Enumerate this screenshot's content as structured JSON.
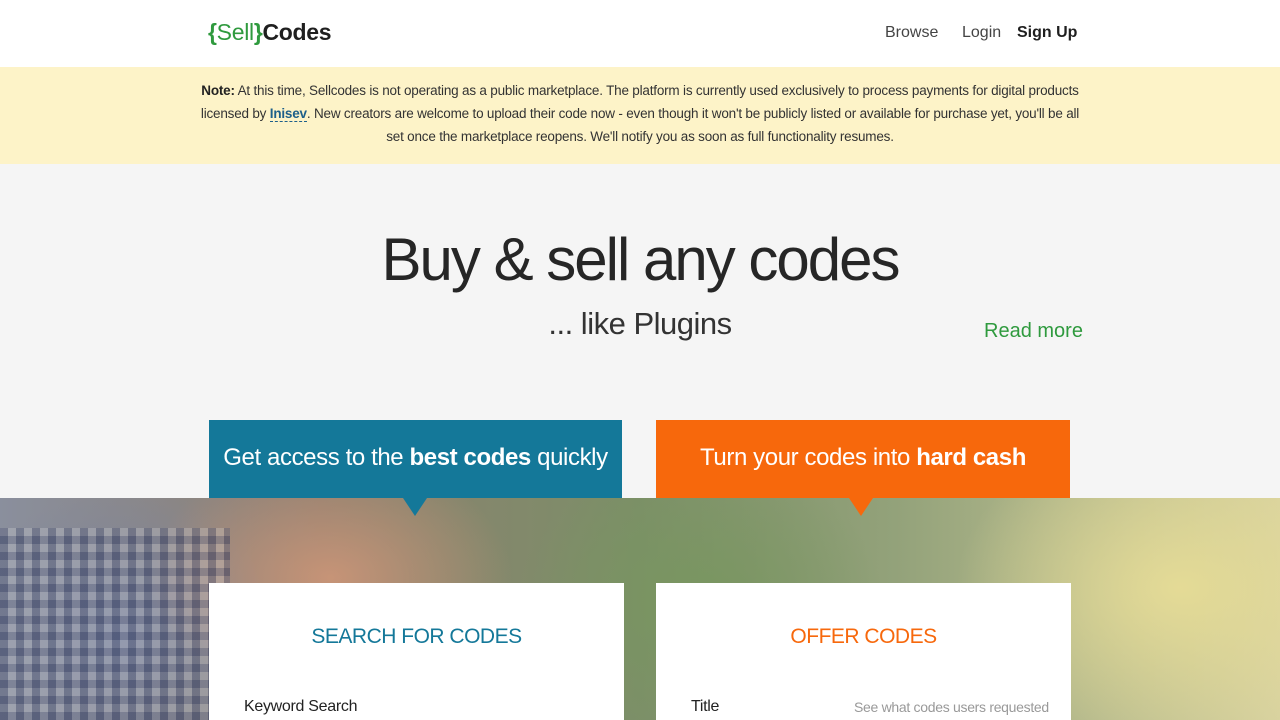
{
  "header": {
    "logo_open": "{",
    "logo_sell": "Sell",
    "logo_close": "}",
    "logo_codes": "Codes",
    "nav": {
      "browse": "Browse",
      "login": "Login",
      "signup": "Sign Up"
    }
  },
  "notice": {
    "label": "Note:",
    "text_1": " At this time, Sellcodes is not operating as a public marketplace. The platform is currently used exclusively to process payments for digital products licensed by ",
    "link": "Inisev",
    "text_2": ". New creators are welcome to upload their code now - even though it won't be publicly listed or available for purchase yet, you'll be all set once the marketplace reopens. We'll notify you as soon as full functionality resumes."
  },
  "hero": {
    "title": "Buy & sell any codes",
    "subtitle": "... like Plugins",
    "read_more": "Read more"
  },
  "banners": {
    "buy": {
      "prefix": "Get access to the ",
      "bold": "best codes",
      "suffix": " quickly",
      "color": "#147899"
    },
    "sell": {
      "prefix": "Turn your codes into ",
      "bold": "hard cash",
      "suffix": "",
      "color": "#f7680c"
    }
  },
  "cards": {
    "search": {
      "title": "SEARCH FOR CODES",
      "field_label": "Keyword Search"
    },
    "offer": {
      "title": "OFFER CODES",
      "field_label": "Title",
      "hint": "See what codes users requested"
    }
  },
  "colors": {
    "brand_green": "#2f9a3e",
    "notice_bg": "#fdf3c8",
    "page_bg": "#f5f5f5"
  }
}
